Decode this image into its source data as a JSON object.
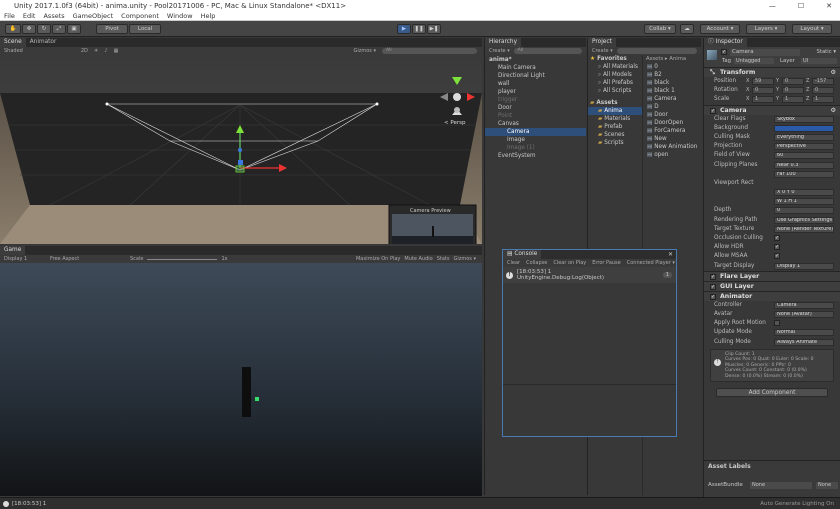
{
  "window": {
    "title": "Unity 2017.1.0f3 (64bit) - anima.unity - Pool20171006 - PC, Mac & Linux Standalone* <DX11>"
  },
  "menu": [
    "File",
    "Edit",
    "Assets",
    "GameObject",
    "Component",
    "Window",
    "Help"
  ],
  "toolbar": {
    "pivot": "Pivot",
    "local": "Local",
    "collab": "Collab ▾",
    "account": "Account ▾",
    "layers": "Layers ▾",
    "layout": "Layout ▾"
  },
  "scene": {
    "tab_scene": "Scene",
    "tab_animator": "Animator",
    "shading": "Shaded",
    "mode_2d": "2D",
    "gizmos": "Gizmos ▾",
    "search_placeholder": "All",
    "persp": "< Persp",
    "camera_preview": "Camera Preview"
  },
  "game": {
    "tab": "Game",
    "display": "Display 1",
    "aspect": "Free Aspect",
    "scale_label": "Scale",
    "scale_value": "1x",
    "maximize": "Maximize On Play",
    "mute": "Mute Audio",
    "stats": "Stats",
    "gizmos": "Gizmos ▾"
  },
  "hierarchy": {
    "tab": "Hierarchy",
    "create": "Create ▾",
    "search_placeholder": "All",
    "items": [
      {
        "label": "anima*",
        "indent": 0,
        "cls": "bold"
      },
      {
        "label": "Main Camera",
        "indent": 1,
        "cls": ""
      },
      {
        "label": "Directional Light",
        "indent": 1,
        "cls": ""
      },
      {
        "label": "wall",
        "indent": 1,
        "cls": ""
      },
      {
        "label": "player",
        "indent": 1,
        "cls": ""
      },
      {
        "label": "trigger",
        "indent": 1,
        "cls": "dim"
      },
      {
        "label": "Door",
        "indent": 1,
        "cls": ""
      },
      {
        "label": "Point",
        "indent": 1,
        "cls": "dim"
      },
      {
        "label": "Canvas",
        "indent": 1,
        "cls": ""
      },
      {
        "label": "Camera",
        "indent": 2,
        "cls": "sel"
      },
      {
        "label": "Image",
        "indent": 2,
        "cls": ""
      },
      {
        "label": "Image (1)",
        "indent": 2,
        "cls": "dim"
      },
      {
        "label": "EventSystem",
        "indent": 1,
        "cls": ""
      }
    ]
  },
  "project": {
    "tab": "Project",
    "create": "Create ▾",
    "breadcrumb": "Assets ▸ Anima",
    "favorites_label": "Favorites",
    "favorites": [
      "All Materials",
      "All Models",
      "All Prefabs",
      "All Scripts"
    ],
    "assets_label": "Assets",
    "folders": [
      "Anima",
      "Materials",
      "Prefab",
      "Scenes",
      "Scripts"
    ],
    "files": [
      "0",
      "B2",
      "black",
      "black 1",
      "Camera",
      "D",
      "Door",
      "DoorOpen",
      "ForCamera",
      "New",
      "New Animation",
      "open"
    ]
  },
  "console": {
    "tab": "Console",
    "buttons": [
      "Clear",
      "Collapse",
      "Clear on Play",
      "Error Pause",
      "Connected Player ▾"
    ],
    "count": "1",
    "msg_line1": "[18:03:53] 1",
    "msg_line2": "UnityEngine.Debug:Log(Object)"
  },
  "inspector": {
    "tab": "Inspector",
    "object_name": "Camera",
    "static": "Static ▾",
    "tag_label": "Tag",
    "tag": "Untagged",
    "layer_label": "Layer",
    "layer": "UI",
    "transform": {
      "title": "Transform",
      "rows": [
        {
          "label": "Position",
          "x": "59",
          "y": "0",
          "z": "-157"
        },
        {
          "label": "Rotation",
          "x": "0",
          "y": "0",
          "z": "0"
        },
        {
          "label": "Scale",
          "x": "1",
          "y": "1",
          "z": "1"
        }
      ]
    },
    "camera": {
      "title": "Camera",
      "props": [
        {
          "label": "Clear Flags",
          "value": "Skybox"
        },
        {
          "label": "Background",
          "value": ""
        },
        {
          "label": "Culling Mask",
          "value": "Everything"
        },
        {
          "label": "Projection",
          "value": "Perspective"
        },
        {
          "label": "Field of View",
          "value": "60"
        },
        {
          "label": "Clipping Planes",
          "value": "Near  0.3"
        },
        {
          "label": "",
          "value": "Far   100"
        },
        {
          "label": "Viewport Rect",
          "value": ""
        },
        {
          "label": "",
          "value": "X 0        Y 0"
        },
        {
          "label": "",
          "value": "W 1        H 1"
        },
        {
          "label": "Depth",
          "value": "0"
        },
        {
          "label": "Rendering Path",
          "value": "Use Graphics Settings"
        },
        {
          "label": "Target Texture",
          "value": "None (Render Texture)"
        },
        {
          "label": "Occlusion Culling",
          "value": "✓"
        },
        {
          "label": "Allow HDR",
          "value": "✓"
        },
        {
          "label": "Allow MSAA",
          "value": "✓"
        },
        {
          "label": "Target Display",
          "value": "Display 1"
        }
      ]
    },
    "flare": "Flare Layer",
    "gui": "GUI Layer",
    "animator": {
      "title": "Animator",
      "props": [
        {
          "label": "Controller",
          "value": "Camera"
        },
        {
          "label": "Avatar",
          "value": "None (Avatar)"
        },
        {
          "label": "Apply Root Motion",
          "value": ""
        },
        {
          "label": "Update Mode",
          "value": "Normal"
        },
        {
          "label": "Culling Mode",
          "value": "Always Animate"
        }
      ],
      "info": [
        "Clip Count: 1",
        "Curves Pos: 0 Quat: 0 Euler: 0 Scale: 0",
        "Muscles: 0 Generic: 0 PPtr: 0",
        "Curves Count: 0 Constant: 0 (0.0%)",
        "Dense: 0 (0.0%) Stream: 0 (0.0%)"
      ]
    },
    "add_component": "Add Component",
    "asset_labels": "Asset Labels",
    "asset_bundle": "AssetBundle",
    "bundle_value": "None",
    "bundle_variant": "None"
  },
  "status": {
    "text": "[18:03:53] 1",
    "right": "Auto Generate Lighting On"
  },
  "colors": {
    "accent": "#2e4f7a",
    "background": "#383838"
  }
}
